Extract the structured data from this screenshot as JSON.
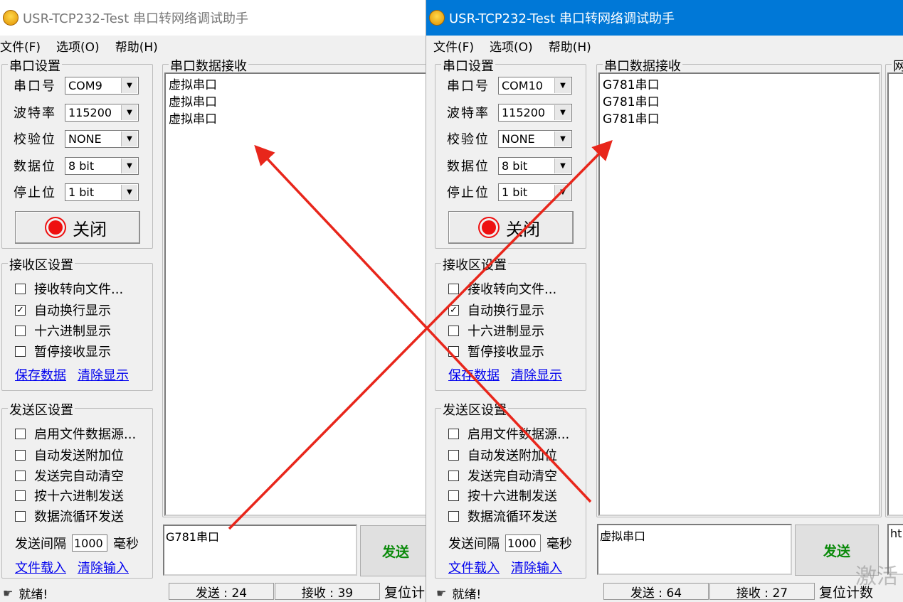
{
  "colors": {
    "accent": "#0078d7",
    "arrow_red": "#e8261b",
    "send_green": "#0a8a0a",
    "link_blue": "#0000ee"
  },
  "left": {
    "title": "USR-TCP232-Test 串口转网络调试助手",
    "menu": [
      "文件(F)",
      "选项(O)",
      "帮助(H)"
    ],
    "serial_group_title": "串口设置",
    "port_label": "串口号",
    "port_value": "COM9",
    "baud_label": "波特率",
    "baud_value": "115200",
    "parity_label": "校验位",
    "parity_value": "NONE",
    "data_label": "数据位",
    "data_value": "8 bit",
    "stop_label": "停止位",
    "stop_value": "1 bit",
    "open_button_label": "关闭",
    "recv_settings_title": "接收区设置",
    "recv_options": [
      {
        "label": "接收转向文件...",
        "checked": false
      },
      {
        "label": "自动换行显示",
        "checked": true
      },
      {
        "label": "十六进制显示",
        "checked": false
      },
      {
        "label": "暂停接收显示",
        "checked": false
      }
    ],
    "save_data_link": "保存数据",
    "clear_display_link": "清除显示",
    "send_settings_title": "发送区设置",
    "send_options": [
      {
        "label": "启用文件数据源...",
        "checked": false
      },
      {
        "label": "自动发送附加位",
        "checked": false
      },
      {
        "label": "发送完自动清空",
        "checked": false
      },
      {
        "label": "按十六进制发送",
        "checked": false
      },
      {
        "label": "数据流循环发送",
        "checked": false
      }
    ],
    "interval_label": "发送间隔",
    "interval_value": "1000",
    "interval_unit": "毫秒",
    "file_load_link": "文件载入",
    "clear_input_link": "清除输入",
    "recv_area_title": "串口数据接收",
    "recv_lines": [
      "虚拟串口",
      "虚拟串口",
      "虚拟串口"
    ],
    "send_text": "G781串口",
    "send_button_label": "发送",
    "status_ready": "就绪!",
    "status_sent": "发送 : 24",
    "status_recv": "接收 : 39",
    "reset_count_label": "复位计"
  },
  "right": {
    "title": "USR-TCP232-Test 串口转网络调试助手",
    "menu": [
      "文件(F)",
      "选项(O)",
      "帮助(H)"
    ],
    "serial_group_title": "串口设置",
    "port_label": "串口号",
    "port_value": "COM10",
    "baud_label": "波特率",
    "baud_value": "115200",
    "parity_label": "校验位",
    "parity_value": "NONE",
    "data_label": "数据位",
    "data_value": "8 bit",
    "stop_label": "停止位",
    "stop_value": "1 bit",
    "open_button_label": "关闭",
    "recv_settings_title": "接收区设置",
    "recv_options": [
      {
        "label": "接收转向文件...",
        "checked": false
      },
      {
        "label": "自动换行显示",
        "checked": true
      },
      {
        "label": "十六进制显示",
        "checked": false
      },
      {
        "label": "暂停接收显示",
        "checked": false
      }
    ],
    "save_data_link": "保存数据",
    "clear_display_link": "清除显示",
    "send_settings_title": "发送区设置",
    "send_options": [
      {
        "label": "启用文件数据源...",
        "checked": false
      },
      {
        "label": "自动发送附加位",
        "checked": false
      },
      {
        "label": "发送完自动清空",
        "checked": false
      },
      {
        "label": "按十六进制发送",
        "checked": false
      },
      {
        "label": "数据流循环发送",
        "checked": false
      }
    ],
    "interval_label": "发送间隔",
    "interval_value": "1000",
    "interval_unit": "毫秒",
    "file_load_link": "文件载入",
    "clear_input_link": "清除输入",
    "recv_area_title": "串口数据接收",
    "recv_lines": [
      "G781串口",
      "G781串口",
      "G781串口"
    ],
    "send_text": "虚拟串口",
    "send_button_label": "发送",
    "status_ready": "就绪!",
    "status_sent": "发送 : 64",
    "status_recv": "接收 : 27",
    "reset_count_label": "复位计数",
    "extra_panel_title": "网",
    "extra_input_text": "ht"
  },
  "watermark": "激活"
}
